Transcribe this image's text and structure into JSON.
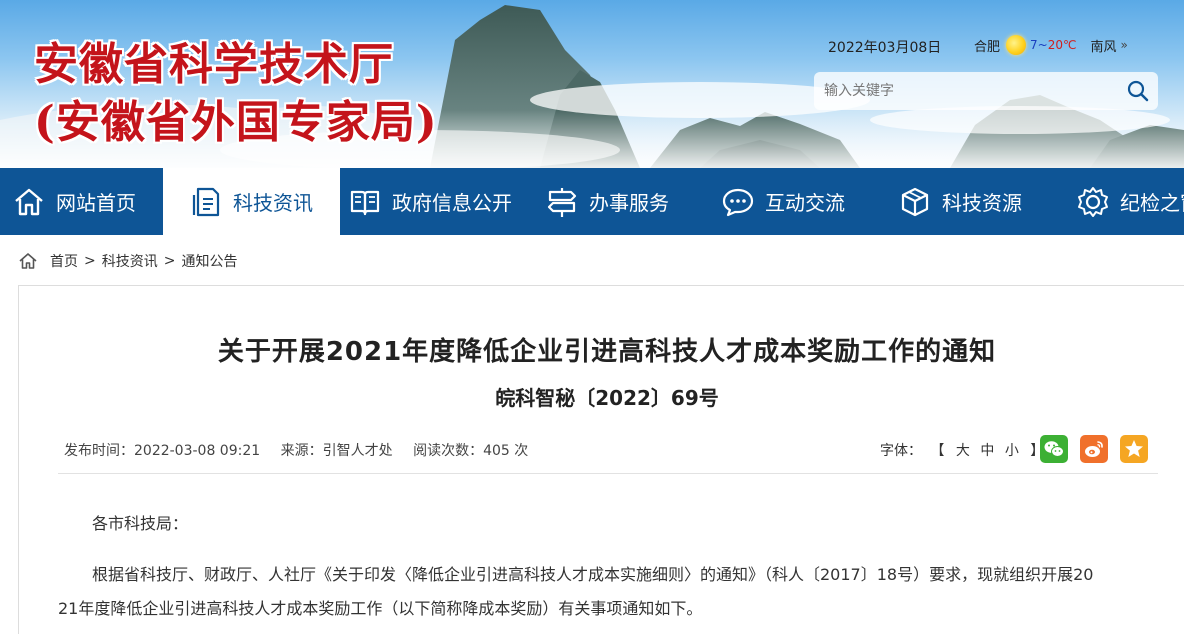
{
  "header": {
    "title_line1": "安徽省科学技术厅",
    "title_line2": "(安徽省外国专家局)",
    "date": "2022年03月08日",
    "weather": {
      "city": "合肥",
      "temp_low": "7",
      "temp_sep": "~",
      "temp_high": "20℃",
      "wind": "南风",
      "more": "»",
      "icon": "sun-icon"
    },
    "search": {
      "placeholder": "输入关键字",
      "value": "",
      "icon": "search-icon"
    }
  },
  "nav": {
    "items": [
      {
        "label": "网站首页",
        "icon": "home-icon"
      },
      {
        "label": "科技资讯",
        "icon": "document-icon",
        "active": true
      },
      {
        "label": "政府信息公开",
        "icon": "book-icon"
      },
      {
        "label": "办事服务",
        "icon": "signpost-icon"
      },
      {
        "label": "互动交流",
        "icon": "chat-icon"
      },
      {
        "label": "科技资源",
        "icon": "cube-icon"
      },
      {
        "label": "纪检之窗",
        "icon": "gear-icon"
      }
    ]
  },
  "breadcrumb": {
    "items": [
      "首页",
      "科技资讯",
      "通知公告"
    ],
    "separator": ">"
  },
  "article": {
    "title": "关于开展2021年度降低企业引进高科技人才成本奖励工作的通知",
    "doc_number": "皖科智秘〔2022〕69号",
    "meta": {
      "publish_time": "发布时间：2022-03-08 09:21",
      "source": "来源：引智人才处",
      "views": "阅读次数：405 次"
    },
    "font_size": {
      "label": "字体：",
      "open": "【",
      "close": "】",
      "large": "大",
      "medium": "中",
      "small": "小"
    },
    "share": [
      "wechat-icon",
      "weibo-icon",
      "favorite-icon"
    ],
    "paragraphs": [
      "各市科技局：",
      "根据省科技厅、财政厅、人社厅《关于印发〈降低企业引进高科技人才成本实施细则〉的通知》（科人〔2017〕18号）要求，现就组织开展20",
      "21年度降低企业引进高科技人才成本奖励工作（以下简称降成本奖励）有关事项通知如下。"
    ]
  },
  "colors": {
    "brand_red": "#c4141b",
    "nav_blue": "#0e5596",
    "wechat_green": "#3cb034",
    "weibo_orange": "#f0702b",
    "favorite_orange": "#f5a623"
  }
}
